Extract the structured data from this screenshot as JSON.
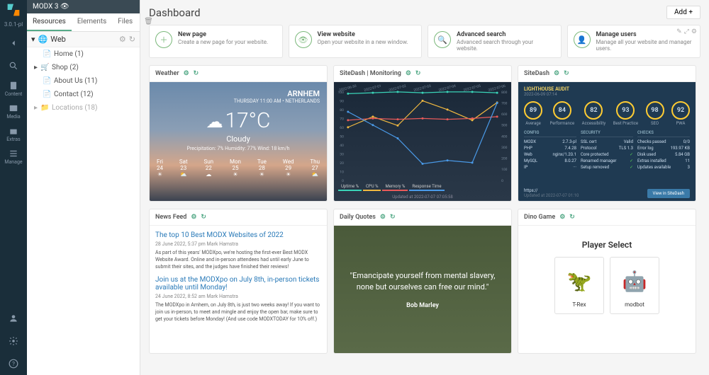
{
  "rail": {
    "version": "3.0.1-pl",
    "items": [
      {
        "name": "back",
        "label": ""
      },
      {
        "name": "search",
        "label": ""
      },
      {
        "name": "content",
        "label": "Content"
      },
      {
        "name": "media",
        "label": "Media"
      },
      {
        "name": "extras",
        "label": "Extras"
      },
      {
        "name": "manage",
        "label": "Manage"
      }
    ]
  },
  "tree": {
    "header": "MODX 3 👁",
    "tabs": [
      {
        "label": "Resources",
        "active": true
      },
      {
        "label": "Elements",
        "active": false
      },
      {
        "label": "Files",
        "active": false
      }
    ],
    "root": "Web",
    "items": [
      {
        "label": "Home (1)",
        "icon": "file"
      },
      {
        "label": "Shop (2)",
        "icon": "cart",
        "expandable": true
      },
      {
        "label": "About Us (11)",
        "icon": "file"
      },
      {
        "label": "Contact (12)",
        "icon": "file"
      },
      {
        "label": "Locations (18)",
        "icon": "folder",
        "expandable": true,
        "muted": true
      }
    ]
  },
  "page": {
    "title": "Dashboard",
    "add": "Add +"
  },
  "quick": [
    {
      "title": "New page",
      "desc": "Create a new page for your website.",
      "icon": "plus"
    },
    {
      "title": "View website",
      "desc": "Open your website in a new window.",
      "icon": "eye"
    },
    {
      "title": "Advanced search",
      "desc": "Advanced search through your website.",
      "icon": "search"
    },
    {
      "title": "Manage users",
      "desc": "Manage all your website and manager users.",
      "icon": "user",
      "acts": true
    }
  ],
  "weather": {
    "title": "Weather",
    "location": "ARNHEM",
    "datetime": "THURSDAY 11:00 AM  •  NETHERLANDS",
    "temp": "17°C",
    "cond": "Cloudy",
    "detail": "Precipitation: 7%   Humidity: 77%   Wind: 18 km/h",
    "forecast": [
      {
        "d": "Fri",
        "t": "24",
        "i": "☀"
      },
      {
        "d": "Sat",
        "t": "23",
        "i": "⛅"
      },
      {
        "d": "Sun",
        "t": "22",
        "i": "☁"
      },
      {
        "d": "Mon",
        "t": "25",
        "i": "☀"
      },
      {
        "d": "Tue",
        "t": "28",
        "i": "☀"
      },
      {
        "d": "Wed",
        "t": "29",
        "i": "☀"
      },
      {
        "d": "Thu",
        "t": "27",
        "i": "⛅"
      }
    ]
  },
  "monitoring": {
    "title": "SiteDash | Monitoring",
    "dates": [
      "2022-06-30",
      "2022-07-01",
      "2022-07-02",
      "2022-07-03",
      "2022-07-04",
      "2022-07-05",
      "2022-07-06"
    ],
    "yticks": [
      "100",
      "90",
      "80",
      "70",
      "60",
      "50",
      "40",
      "30",
      "20",
      "10",
      "0"
    ],
    "rticks": [
      "800",
      "700",
      "600",
      "500",
      "400",
      "300",
      "200",
      "100",
      "0"
    ],
    "legend": [
      "Uptime %",
      "CPU %",
      "Memory %",
      "Response Time"
    ],
    "legend_colors": [
      "#3ad4b8",
      "#f0b840",
      "#e85a5a",
      "#4a9ae8"
    ],
    "updated": "Updated at 2022-07-07 07:05:58"
  },
  "sitedash": {
    "title": "SiteDash",
    "audit": "LIGHTHOUSE AUDIT",
    "audit_dt": "2022-06-09 07:14",
    "scores": [
      {
        "v": "89",
        "l": "Average"
      },
      {
        "v": "84",
        "l": "Performance"
      },
      {
        "v": "82",
        "l": "Accessibility"
      },
      {
        "v": "93",
        "l": "Best Practice"
      },
      {
        "v": "98",
        "l": "SEO"
      },
      {
        "v": "92",
        "l": "PWA"
      }
    ],
    "cols": {
      "config": {
        "h": "CONFIG",
        "rows": [
          [
            "MODX",
            "2.7.3-pl"
          ],
          [
            "PHP",
            "7.4.28"
          ],
          [
            "Web",
            "nginx/1.20.1"
          ],
          [
            "MySQL",
            "8.0.27"
          ],
          [
            "IP",
            "···"
          ]
        ]
      },
      "security": {
        "h": "SECURITY",
        "rows": [
          [
            "SSL cert",
            "Valid"
          ],
          [
            "Protocol",
            "TLS 1.3"
          ],
          [
            "Core protected",
            "✓"
          ],
          [
            "Renamed manager",
            "✓"
          ],
          [
            "Setup removed",
            "✓"
          ]
        ]
      },
      "checks": {
        "h": "CHECKS",
        "rows": [
          [
            "Checks passed",
            "0/0"
          ],
          [
            "Error log",
            "193.97 KB"
          ],
          [
            "Disk used",
            "5.84 GB"
          ],
          [
            "Extras installed",
            "11"
          ],
          [
            "Updates available",
            "3"
          ]
        ]
      }
    },
    "url": "https://",
    "upd": "Updated at 2022-07-07 01:10",
    "btn": "View in SiteDash"
  },
  "news": {
    "title": "News Feed",
    "items": [
      {
        "h": "The top 10 Best MODX Websites of 2022",
        "m": "28 June 2022, 5:37 pm   Mark Hamstra",
        "p": "As part of this years' MODXpo, we're hosting the first-ever Best MODX Website Award. Online and in-person attendees had until early June to submit their sites, and the judges have finished their reviews!"
      },
      {
        "h": "Join us at the MODXpo on July 8th, in-person tickets available until Monday!",
        "m": "24 June 2022, 8:52 am   Mark Hamstra",
        "p": "The MODXpo in Arnhem, on July 8th, is just two weeks away! If you want to join us in-person, to meet and mingle and enjoy the open bar, make sure to get your tickets before Monday! (And use code MODXTODAY for 10% off.)"
      }
    ]
  },
  "quotes": {
    "title": "Daily Quotes",
    "quote": "\"Emancipate yourself from mental slavery, none but ourselves can free our mind.\"",
    "author": "Bob Marley"
  },
  "dino": {
    "title": "Dino Game",
    "header": "Player Select",
    "players": [
      {
        "n": "T-Rex"
      },
      {
        "n": "modbot"
      }
    ]
  },
  "chart_data": {
    "type": "line",
    "title": "SiteDash Monitoring",
    "x": [
      "2022-06-30",
      "2022-07-01",
      "2022-07-02",
      "2022-07-03",
      "2022-07-04",
      "2022-07-05",
      "2022-07-06"
    ],
    "ylim": [
      0,
      100
    ],
    "y2lim": [
      0,
      800
    ],
    "series": [
      {
        "name": "Uptime %",
        "values": [
          98,
          99,
          100,
          99,
          100,
          100,
          99
        ],
        "color": "#3ad4b8",
        "axis": "left"
      },
      {
        "name": "CPU %",
        "values": [
          60,
          72,
          62,
          90,
          80,
          68,
          88
        ],
        "color": "#f0b840",
        "axis": "left"
      },
      {
        "name": "Memory %",
        "values": [
          68,
          70,
          69,
          70,
          69,
          70,
          72
        ],
        "color": "#e85a5a",
        "axis": "left"
      },
      {
        "name": "Response Time",
        "values": [
          620,
          500,
          380,
          150,
          180,
          160,
          700
        ],
        "color": "#4a9ae8",
        "axis": "right"
      }
    ]
  }
}
